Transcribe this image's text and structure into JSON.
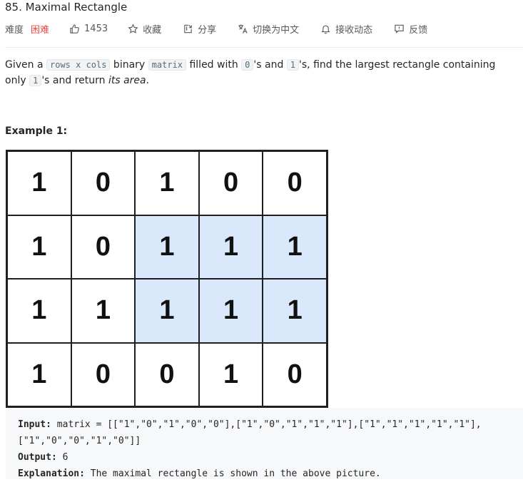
{
  "problem": {
    "title": "85. Maximal Rectangle",
    "difficulty_label": "难度",
    "difficulty": "困难",
    "likes": "1453",
    "actions": {
      "favorite": "收藏",
      "share": "分享",
      "translate": "切换为中文",
      "notify": "接收动态",
      "feedback": "反馈"
    }
  },
  "description": {
    "t1": "Given a ",
    "c1": "rows x cols",
    "t2": " binary ",
    "c2": "matrix",
    "t3": " filled with ",
    "c3": "0",
    "t4": "'s and ",
    "c4": "1",
    "t5": "'s, find the largest rectangle containing only ",
    "c5": "1",
    "t6": "'s and return ",
    "t7": "its area",
    "t8": "."
  },
  "example": {
    "title": "Example 1:",
    "matrix": [
      [
        "1",
        "0",
        "1",
        "0",
        "0"
      ],
      [
        "1",
        "0",
        "1",
        "1",
        "1"
      ],
      [
        "1",
        "1",
        "1",
        "1",
        "1"
      ],
      [
        "1",
        "0",
        "0",
        "1",
        "0"
      ]
    ],
    "highlight": [
      [
        1,
        2
      ],
      [
        1,
        3
      ],
      [
        1,
        4
      ],
      [
        2,
        2
      ],
      [
        2,
        3
      ],
      [
        2,
        4
      ]
    ],
    "input_label": "Input:",
    "input_line1": " matrix = [[\"1\",\"0\",\"1\",\"0\",\"0\"],[\"1\",\"0\",\"1\",\"1\",\"1\"],[\"1\",\"1\",\"1\",\"1\",\"1\"],",
    "input_line2": "[\"1\",\"0\",\"0\",\"1\",\"0\"]]",
    "output_label": "Output:",
    "output_value": " 6",
    "explanation_label": "Explanation:",
    "explanation_value": " The maximal rectangle is shown in the above picture."
  }
}
